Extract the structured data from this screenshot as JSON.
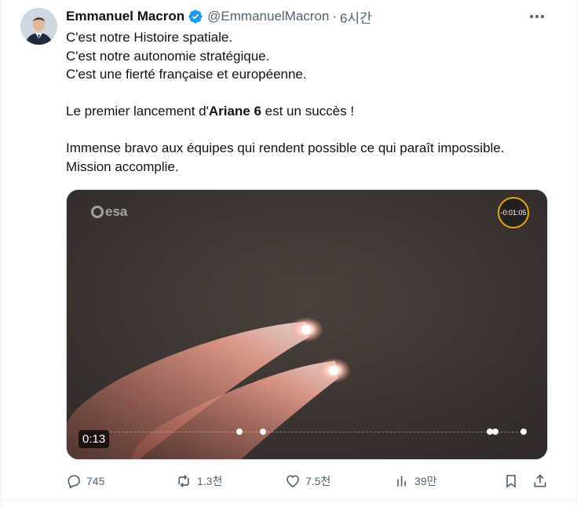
{
  "tweet": {
    "author_name": "Emmanuel Macron",
    "handle": "@EmmanuelMacron",
    "separator": "·",
    "time": "6시간",
    "lines": [
      "C'est notre Histoire spatiale.",
      "C'est notre autonomie stratégique.",
      "C'est une fierté française et européenne."
    ],
    "launch_prefix": "Le premier lancement d'",
    "launch_bold": "Ariane 6",
    "launch_suffix": " est un succès !",
    "closing_lines": [
      "Immense bravo aux équipes qui rendent possible ce qui paraît impossible.",
      "Mission accomplie."
    ]
  },
  "media": {
    "watermark": "esa",
    "countdown": "-0:01:05",
    "timecode": "0:13"
  },
  "actions": {
    "replies": "745",
    "reposts": "1.3천",
    "likes": "7.5천",
    "views": "39만"
  },
  "colors": {
    "verified": "#1d9bf0",
    "secondary_text": "#536471",
    "countdown_ring": "#e4a51a"
  }
}
